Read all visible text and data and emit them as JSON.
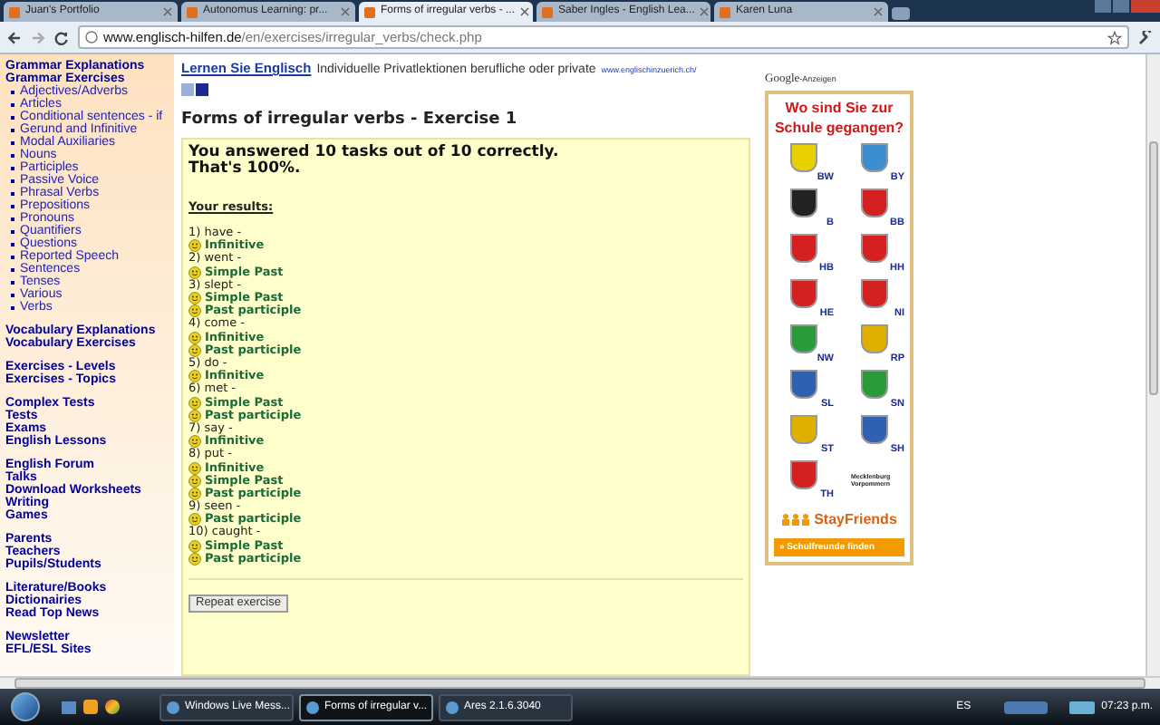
{
  "browser": {
    "tabs": [
      {
        "title": "Juan's Portfolio",
        "selected": false
      },
      {
        "title": "Autonomus Learning: pr...",
        "selected": false
      },
      {
        "title": "Forms of irregular verbs - ...",
        "selected": true
      },
      {
        "title": "Saber Ingles - English Lea...",
        "selected": false
      },
      {
        "title": "Karen Luna",
        "selected": false
      }
    ],
    "url_host": "www.englisch-hilfen.de",
    "url_path": "/en/exercises/irregular_verbs/check.php"
  },
  "sidebar": {
    "groups": [
      {
        "items": [
          {
            "label": "Grammar Explanations",
            "kind": "heading"
          },
          {
            "label": "Grammar Exercises",
            "kind": "heading"
          },
          {
            "label": "Adjectives/Adverbs",
            "kind": "bullet"
          },
          {
            "label": "Articles",
            "kind": "bullet"
          },
          {
            "label": "Conditional sentences - if",
            "kind": "bullet"
          },
          {
            "label": "Gerund and Infinitive",
            "kind": "bullet"
          },
          {
            "label": "Modal Auxiliaries",
            "kind": "bullet"
          },
          {
            "label": "Nouns",
            "kind": "bullet"
          },
          {
            "label": "Participles",
            "kind": "bullet"
          },
          {
            "label": "Passive Voice",
            "kind": "bullet"
          },
          {
            "label": "Phrasal Verbs",
            "kind": "bullet"
          },
          {
            "label": "Prepositions",
            "kind": "bullet"
          },
          {
            "label": "Pronouns",
            "kind": "bullet"
          },
          {
            "label": "Quantifiers",
            "kind": "bullet"
          },
          {
            "label": "Questions",
            "kind": "bullet"
          },
          {
            "label": "Reported Speech",
            "kind": "bullet"
          },
          {
            "label": "Sentences",
            "kind": "bullet"
          },
          {
            "label": "Tenses",
            "kind": "bullet"
          },
          {
            "label": "Various",
            "kind": "bullet"
          },
          {
            "label": "Verbs",
            "kind": "bullet"
          }
        ]
      },
      {
        "items": [
          {
            "label": "Vocabulary Explanations",
            "kind": "heading"
          },
          {
            "label": "Vocabulary Exercises",
            "kind": "heading"
          }
        ]
      },
      {
        "items": [
          {
            "label": "Exercises - Levels",
            "kind": "heading"
          },
          {
            "label": "Exercises - Topics",
            "kind": "heading"
          }
        ]
      },
      {
        "items": [
          {
            "label": "Complex Tests",
            "kind": "heading"
          },
          {
            "label": "Tests",
            "kind": "heading"
          },
          {
            "label": "Exams",
            "kind": "heading"
          },
          {
            "label": "English Lessons",
            "kind": "heading"
          }
        ]
      },
      {
        "items": [
          {
            "label": "English Forum",
            "kind": "heading"
          },
          {
            "label": "Talks",
            "kind": "heading"
          },
          {
            "label": "Download Worksheets",
            "kind": "heading"
          },
          {
            "label": "Writing",
            "kind": "heading"
          },
          {
            "label": "Games",
            "kind": "heading"
          }
        ]
      },
      {
        "items": [
          {
            "label": "Parents",
            "kind": "heading"
          },
          {
            "label": "Teachers",
            "kind": "heading"
          },
          {
            "label": "Pupils/Students",
            "kind": "heading"
          }
        ]
      },
      {
        "items": [
          {
            "label": "Literature/Books",
            "kind": "heading"
          },
          {
            "label": "Dictionairies",
            "kind": "heading"
          },
          {
            "label": "Read Top News",
            "kind": "heading"
          }
        ]
      },
      {
        "items": [
          {
            "label": "Newsletter",
            "kind": "heading"
          },
          {
            "label": "EFL/ESL Sites",
            "kind": "heading"
          }
        ]
      }
    ]
  },
  "top_ad": {
    "link": "Lernen Sie Englisch",
    "text": "Individuelle Privatlektionen berufliche oder private",
    "url": "www.englischinzuerich.ch/"
  },
  "exercise": {
    "title": "Forms of irregular verbs - Exercise 1",
    "summary": [
      "You answered 10 tasks out of 10 correctly.",
      "That's 100%."
    ],
    "results_label": "Your results:",
    "results": [
      {
        "word": "1) have -",
        "answers": [
          "Infinitive"
        ]
      },
      {
        "word": "2) went -",
        "answers": [
          "Simple Past"
        ]
      },
      {
        "word": "3) slept -",
        "answers": [
          "Simple Past",
          "Past participle"
        ]
      },
      {
        "word": "4) come -",
        "answers": [
          "Infinitive",
          "Past participle"
        ]
      },
      {
        "word": "5) do -",
        "answers": [
          "Infinitive"
        ]
      },
      {
        "word": "6) met -",
        "answers": [
          "Simple Past",
          "Past participle"
        ]
      },
      {
        "word": "7) say -",
        "answers": [
          "Infinitive"
        ]
      },
      {
        "word": "8) put -",
        "answers": [
          "Infinitive",
          "Simple Past",
          "Past participle"
        ]
      },
      {
        "word": "9) seen -",
        "answers": [
          "Past participle"
        ]
      },
      {
        "word": "10) caught -",
        "answers": [
          "Simple Past",
          "Past participle"
        ]
      }
    ],
    "repeat_button": "Repeat exercise"
  },
  "side_ad": {
    "google": "Google",
    "anzeigen": "-Anzeigen",
    "headline": "Wo sind Sie zur Schule gegangen?",
    "states": [
      {
        "code": "BW",
        "color": "#e8d000"
      },
      {
        "code": "BY",
        "color": "#3b8fd0"
      },
      {
        "code": "B",
        "color": "#222222"
      },
      {
        "code": "BB",
        "color": "#d42020"
      },
      {
        "code": "HB",
        "color": "#d42020"
      },
      {
        "code": "HH",
        "color": "#d42020"
      },
      {
        "code": "HE",
        "color": "#d42020"
      },
      {
        "code": "NI",
        "color": "#d42020"
      },
      {
        "code": "NW",
        "color": "#2a9a3a"
      },
      {
        "code": "RP",
        "color": "#e0b000"
      },
      {
        "code": "SL",
        "color": "#3060b0"
      },
      {
        "code": "SN",
        "color": "#2a9a3a"
      },
      {
        "code": "ST",
        "color": "#e0b000"
      },
      {
        "code": "SH",
        "color": "#3060b0"
      },
      {
        "code": "TH",
        "color": "#d42020"
      }
    ],
    "mv": "Mecklenburg Vorpommern",
    "brand": "StayFriends",
    "cta": "» Schulfreunde finden"
  },
  "taskbar": {
    "buttons": [
      {
        "label": "Windows Live Mess...",
        "selected": false
      },
      {
        "label": "Forms of irregular v...",
        "selected": true
      },
      {
        "label": "Ares 2.1.6.3040",
        "selected": false
      }
    ],
    "language": "ES",
    "time": "07:23 p.m."
  }
}
